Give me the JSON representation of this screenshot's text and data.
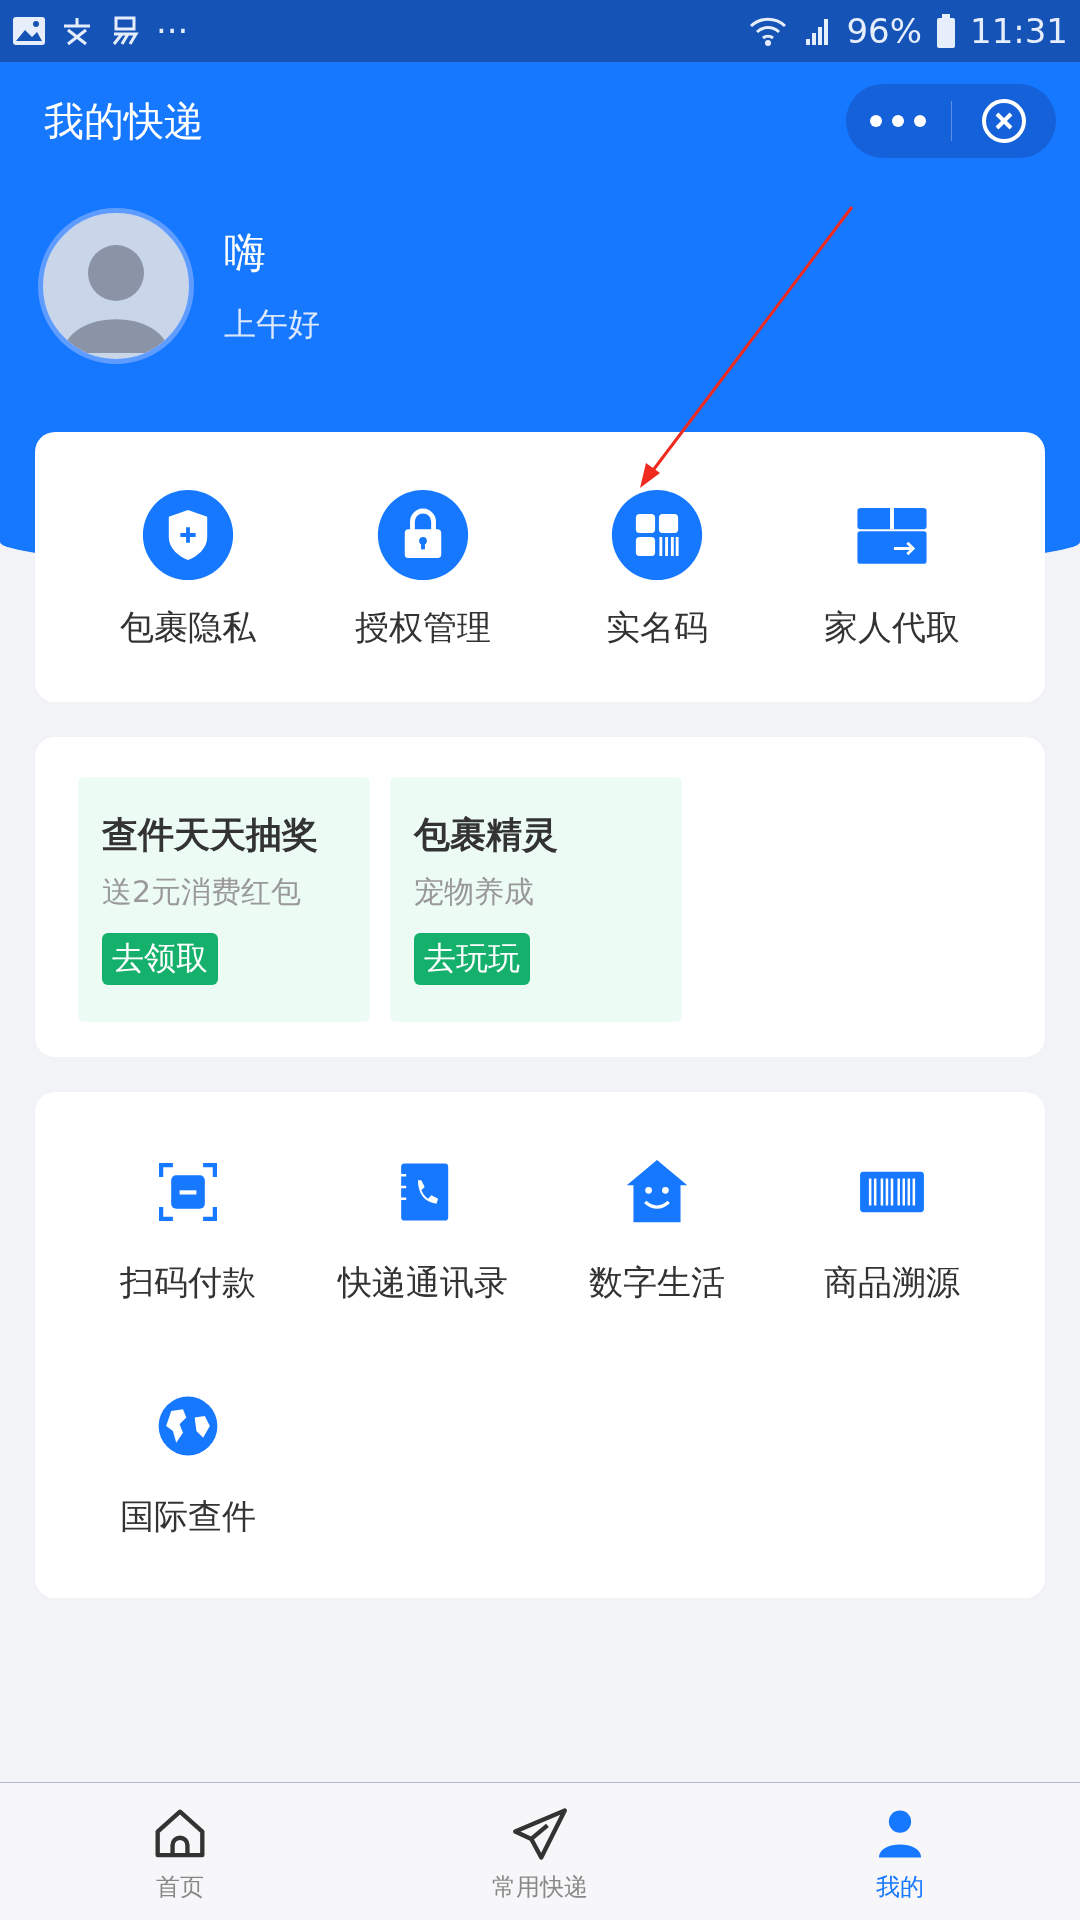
{
  "status_bar": {
    "battery": "96%",
    "time": "11:31",
    "overflow": "···"
  },
  "header": {
    "title": "我的快递",
    "profile": {
      "name": "嗨",
      "greeting": "上午好"
    }
  },
  "services": [
    {
      "label": "包裹隐私"
    },
    {
      "label": "授权管理"
    },
    {
      "label": "实名码"
    },
    {
      "label": "家人代取"
    }
  ],
  "promos": [
    {
      "title": "查件天天抽奖",
      "subtitle": "送2元消费红包",
      "button": "去领取"
    },
    {
      "title": "包裹精灵",
      "subtitle": "宠物养成",
      "button": "去玩玩"
    }
  ],
  "tools": [
    {
      "label": "扫码付款"
    },
    {
      "label": "快递通讯录"
    },
    {
      "label": "数字生活"
    },
    {
      "label": "商品溯源"
    },
    {
      "label": "国际查件"
    }
  ],
  "tab_bar": [
    {
      "label": "首页",
      "selected": false
    },
    {
      "label": "常用快递",
      "selected": false
    },
    {
      "label": "我的",
      "selected": true
    }
  ]
}
